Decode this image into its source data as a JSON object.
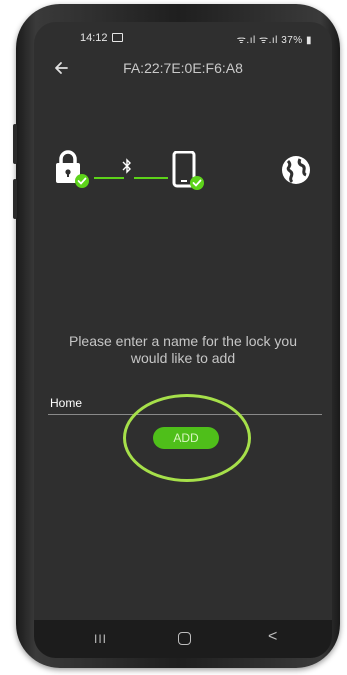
{
  "status_bar": {
    "time": "14:12",
    "signal": "ᯤ.ıl ᯤ.ıl",
    "battery": "37%"
  },
  "header": {
    "title": "FA:22:7E:0E:F6:A8"
  },
  "connection": {
    "icons": [
      "lock-icon",
      "check-icon",
      "bluetooth-icon",
      "phone-icon",
      "check-icon",
      "globe-icon"
    ],
    "link_color": "#5dd31a"
  },
  "form": {
    "prompt": "Please enter a name for the lock you would like to add",
    "name_value": "Home",
    "add_label": "ADD"
  },
  "nav": {
    "recent": "III",
    "back": "<"
  },
  "colors": {
    "accent": "#4fbf1a",
    "highlight": "#a6e04a",
    "screen_bg": "#2f2f2f"
  }
}
